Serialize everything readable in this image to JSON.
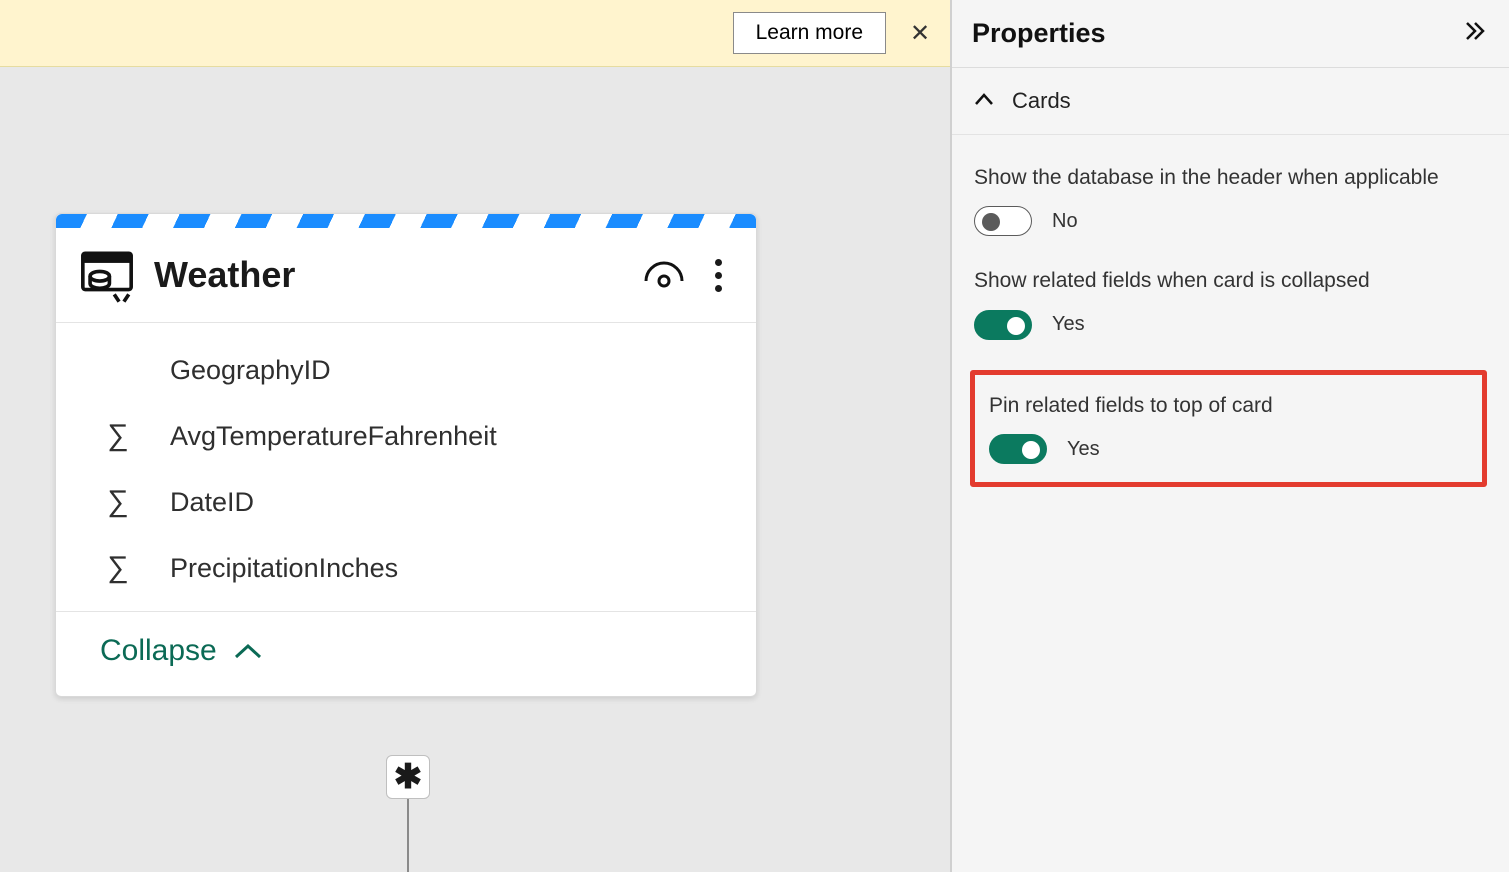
{
  "info_bar": {
    "learn_more": "Learn more",
    "close_glyph": "✕"
  },
  "card": {
    "title": "Weather",
    "collapse_label": "Collapse",
    "relationship_glyph": "✱",
    "fields": [
      {
        "name": "GeographyID",
        "agg": false
      },
      {
        "name": "AvgTemperatureFahrenheit",
        "agg": true
      },
      {
        "name": "DateID",
        "agg": true
      },
      {
        "name": "PrecipitationInches",
        "agg": true
      }
    ]
  },
  "panel": {
    "title": "Properties",
    "section": "Cards",
    "items": [
      {
        "label": "Show the database in the header when applicable",
        "value": "No",
        "on": false,
        "highlight": false
      },
      {
        "label": "Show related fields when card is collapsed",
        "value": "Yes",
        "on": true,
        "highlight": false
      },
      {
        "label": "Pin related fields to top of card",
        "value": "Yes",
        "on": true,
        "highlight": true
      }
    ]
  }
}
